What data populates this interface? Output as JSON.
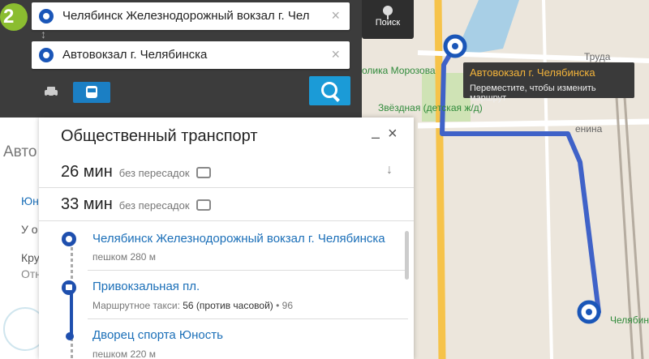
{
  "search": {
    "badge": "2",
    "from": "Челябинск Железнодорожный вокзал г. Чел",
    "to": "Автовокзал г. Челябинска",
    "clear_glyph": "×",
    "swap_glyph": "↕",
    "search_label": "Поиск",
    "modes": [
      "car-icon",
      "bus-icon"
    ]
  },
  "map": {
    "labels": [
      "Труда",
      "олика Морозова",
      "Звёздная (детская ж/д)",
      "Звёздная (детская ж/д)",
      "енина",
      "Челябинск"
    ],
    "tooltip": {
      "title": "Автовокзал г. Челябинска",
      "hint": "Переместите, чтобы изменить маршрут"
    },
    "colors": {
      "route": "#3f62c8",
      "road": "#f6c34a",
      "tooltip_title": "#f4b43a"
    }
  },
  "sidebar": {
    "stubs": [
      "Авто",
      "Юн",
      "У о",
      "Кру",
      "Отн"
    ]
  },
  "transport": {
    "title": "Общественный транспорт",
    "minimize": "–",
    "close": "×",
    "options": [
      {
        "time": "26 мин",
        "note": "без пересадок"
      },
      {
        "time": "33 мин",
        "note": "без пересадок"
      }
    ],
    "expand_arrow": "↓",
    "steps": [
      {
        "name": "Челябинск Железнодорожный вокзал г. Челябинска",
        "sub": "пешком 280 м"
      },
      {
        "name": "Привокзальная пл.",
        "sub_prefix": "Маршрутное такси:",
        "sub_routes": "56 (против часовой)",
        "sub_extra": "• 96"
      },
      {
        "name": "Дворец спорта Юность",
        "sub": "пешком 220 м"
      }
    ]
  }
}
